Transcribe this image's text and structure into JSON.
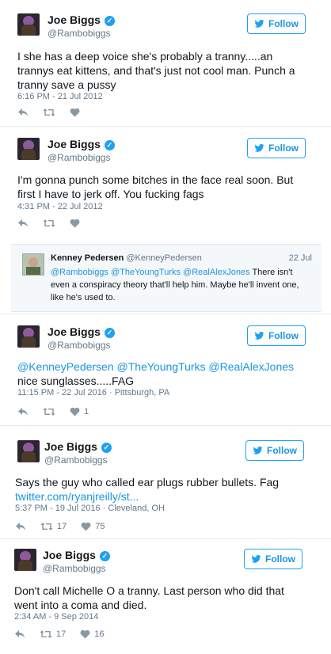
{
  "colors": {
    "accent": "#1da1f2",
    "text": "#14171a",
    "muted": "#657786"
  },
  "follow_label": "Follow",
  "tweets": [
    {
      "name": "Joe Biggs",
      "handle": "@Rambobiggs",
      "text": "I she has a deep voice she's probably a tranny.....an trannys eat kittens, and that's just not cool man. Punch a tranny save a pussy",
      "meta": "6:16 PM - 21 Jul 2012"
    },
    {
      "name": "Joe Biggs",
      "handle": "@Rambobiggs",
      "text": "I'm gonna punch some bitches in the face real soon. But first I have to jerk off. You fucking fags",
      "meta": "4:31 PM - 22 Jul 2012"
    },
    {
      "name": "Joe Biggs",
      "handle": "@Rambobiggs",
      "mentions": "@KenneyPedersen @TheYoungTurks @RealAlexJones",
      "text_rest": " nice sunglasses.....FAG",
      "meta": "11:15 PM - 22 Jul 2016 · Pittsburgh, PA",
      "likes": "1"
    },
    {
      "name": "Joe Biggs",
      "handle": "@Rambobiggs",
      "text": "Says the guy who called ear plugs rubber bullets. Fag",
      "link": "twitter.com/ryanjreilly/st...",
      "meta": "5:37 PM - 19 Jul 2016 · Cleveland, OH",
      "retweets": "17",
      "likes": "75"
    },
    {
      "name": "Joe Biggs",
      "handle": "@Rambobiggs",
      "text": "Don't call Michelle O a tranny. Last person who did that went into a coma and died.",
      "meta": "2:34 AM - 9 Sep 2014",
      "retweets": "17",
      "likes": "16"
    }
  ],
  "quoted": {
    "name": "Kenney Pedersen",
    "handle": "@KenneyPedersen",
    "date": "22 Jul",
    "mentions": "@Rambobiggs @TheYoungTurks @RealAlexJones",
    "text": " There isn't even a conspiracy theory that'll help him. Maybe he'll invent one, like he's used to."
  }
}
